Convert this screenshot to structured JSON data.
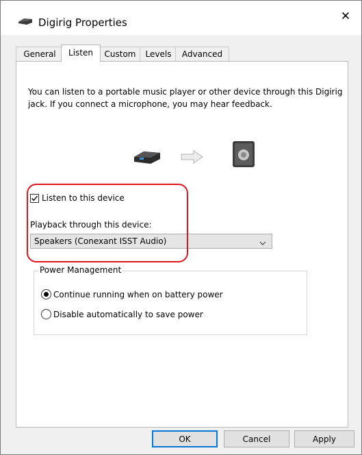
{
  "window": {
    "title": "Digirig Properties",
    "close_label": "✕",
    "app_icon": "audio-jack-icon"
  },
  "tabs": [
    {
      "label": "General"
    },
    {
      "label": "Listen",
      "active": true
    },
    {
      "label": "Custom"
    },
    {
      "label": "Levels"
    },
    {
      "label": "Advanced"
    }
  ],
  "listen": {
    "description": "You can listen to a portable music player or other device through this Digirig jack.  If you connect a microphone, you may hear feedback.",
    "listen_checkbox_label": "Listen to this device",
    "listen_checked": true,
    "playback_label": "Playback through this device:",
    "playback_selected": "Speakers (Conexant ISST Audio)"
  },
  "power": {
    "group_title": "Power Management",
    "option_continue": "Continue running when on battery power",
    "option_disable": "Disable automatically to save power",
    "selected": "continue"
  },
  "buttons": {
    "ok": "OK",
    "cancel": "Cancel",
    "apply": "Apply"
  },
  "colors": {
    "highlight": "#e0141e",
    "default_button_border": "#0078d7"
  }
}
